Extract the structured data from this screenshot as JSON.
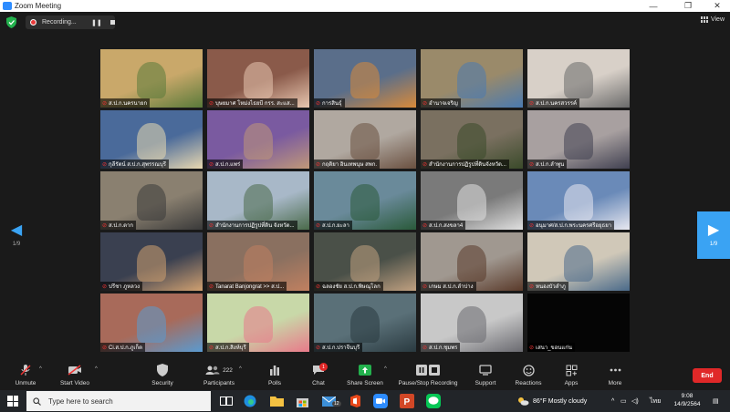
{
  "window": {
    "title": "Zoom Meeting"
  },
  "recording": {
    "label": "Recording..."
  },
  "view": {
    "label": "View"
  },
  "pager": {
    "left": "1/9",
    "right": "1/9"
  },
  "participants": [
    {
      "name": "ส.ป.ก.นครนายก",
      "bg": "#c9a86a",
      "fg": "#5a7a3a"
    },
    {
      "name": "บุษยมาศ โหม่งไธยบี กรร. สะแส...",
      "bg": "#8a5a4a",
      "fg": "#e8c7b0"
    },
    {
      "name": "การสินธุ์",
      "bg": "#5a6e8a",
      "fg": "#d88a3a"
    },
    {
      "name": "อำนาจเจริญ",
      "bg": "#9a8a6a",
      "fg": "#4a7ab0"
    },
    {
      "name": "ส.ป.ก.นครสวรรค์",
      "bg": "#d8d0c8",
      "fg": "#6a6a6a"
    },
    {
      "name": "กุลีรัตน์ ส.ป.ก.สุพรรณบุรี",
      "bg": "#4a6a9a",
      "fg": "#e8d8b0"
    },
    {
      "name": "ส.ป.ก.แพร่",
      "bg": "#7a5aa0",
      "fg": "#c09878"
    },
    {
      "name": "กฤติยา อินเทพนุษ สพก.",
      "bg": "#b0a8a0",
      "fg": "#6a5040"
    },
    {
      "name": "สำนักงานการปฏิรูปที่ดินจังหวัด...",
      "bg": "#7a7060",
      "fg": "#3a4a2a"
    },
    {
      "name": "ส.ป.ก.ลำพูน",
      "bg": "#a8a0a0",
      "fg": "#404050"
    },
    {
      "name": "ส.ป.ก.ตาก",
      "bg": "#8a8070",
      "fg": "#3a3a3a"
    },
    {
      "name": "สำนักงานการปฏิรูปที่ดิน จังหวัด...",
      "bg": "#a8b8c8",
      "fg": "#4a6a4a"
    },
    {
      "name": "ส.ป.ก.ยะลา",
      "bg": "#6a8a9a",
      "fg": "#2a5a3a"
    },
    {
      "name": "ส.ป.ก.สงขลา4",
      "bg": "#7a7a7a",
      "fg": "#e0e0e0"
    },
    {
      "name": "อนุมาศ/ส.ป.ก.พระนครศรีอยุธยา",
      "bg": "#6a8ab8",
      "fg": "#e8e8f0"
    },
    {
      "name": "ปรีชา ภูหลวง",
      "bg": "#3a4050",
      "fg": "#d0a070"
    },
    {
      "name": "Tanarat Banjongrat >> ส.ป...",
      "bg": "#8a7060",
      "fg": "#c08060"
    },
    {
      "name": "ฉลองชัย ส.ป.ก.พิษณุโลก",
      "bg": "#4a5048",
      "fg": "#c0a080"
    },
    {
      "name": "เกษม ส.ป.ก.ลำปาง",
      "bg": "#a09890",
      "fg": "#5a3a2a"
    },
    {
      "name": "หนองบัวลำภู",
      "bg": "#d0c8b8",
      "fg": "#4a6a8a"
    },
    {
      "name": "Ci.ส.ป.ก.ภูเก็ต",
      "bg": "#a86a5a",
      "fg": "#5a9ad0"
    },
    {
      "name": "ส.ป.ก.สิงห์บุรี",
      "bg": "#c8d8a8",
      "fg": "#e87a8a"
    },
    {
      "name": "ส.ป.ก.ปราจีนบุรี",
      "bg": "#5a7078",
      "fg": "#2a3a40"
    },
    {
      "name": "ส.ป.ก.ชุมพร",
      "bg": "#c8c8c8",
      "fg": "#6a6a70"
    },
    {
      "name": "เสนา_ขอนแก่น",
      "bg": "#050505",
      "fg": "#050505"
    }
  ],
  "toolbar": {
    "unmute": "Unmute",
    "start_video": "Start Video",
    "security": "Security",
    "participants": "Participants",
    "participants_count": "222",
    "polls": "Polls",
    "chat": "Chat",
    "chat_badge": "1",
    "share_screen": "Share Screen",
    "recording": "Pause/Stop Recording",
    "support": "Support",
    "reactions": "Reactions",
    "apps": "Apps",
    "more": "More",
    "end": "End"
  },
  "taskbar": {
    "search_placeholder": "Type here to search",
    "mail_badge": "12",
    "weather": "86°F  Mostly cloudy",
    "lang": "ไทย",
    "time": "9:08",
    "date": "14/9/2564"
  }
}
